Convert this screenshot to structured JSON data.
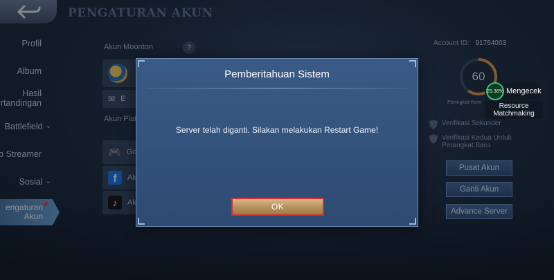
{
  "header": {
    "title": "PENGATURAN AKUN"
  },
  "sidebar": {
    "items": [
      {
        "label": "Profil"
      },
      {
        "label": "Album"
      },
      {
        "label": "Hasil\nrtandingan"
      },
      {
        "label": "Battlefield"
      },
      {
        "label": "o Streamer"
      },
      {
        "label": "Sosial"
      },
      {
        "label": "engaturan\nAkun"
      }
    ]
  },
  "main": {
    "moonton_label": "Akun Moonton",
    "help_symbol": "?",
    "email_stub": "E",
    "platform_label": "Akun Plat",
    "google_stub": "Go",
    "facebook_stub": "Ak",
    "tiktok_stub": "Ak"
  },
  "right_panel": {
    "account_id_label": "Account ID:",
    "account_id_value": "91764003",
    "rank_value": "60",
    "rank_label": "Peringkat Kem",
    "resource_percent": "25.36%",
    "resource_title": "Mengecek",
    "resource_subtitle": "Resource Matchmaking",
    "verify_secondary": "Verifikasi Sekunder",
    "verify_new_device": "Verifikasi Kedua Untuk Perangkat Baru",
    "btn_account_center": "Pusat Akun",
    "btn_switch_account": "Ganti Akun",
    "btn_advance_server": "Advance Server"
  },
  "modal": {
    "title": "Pemberitahuan Sistem",
    "message": "Server telah diganti. Silakan melakukan Restart Game!",
    "ok_label": "OK"
  },
  "colors": {
    "modal_bg": "#3a5b86",
    "ok_button": "#b5905a",
    "ok_highlight_border": "#e02a2a",
    "sidebar_active": "#5a8fc0",
    "rank_ring": "#e69a45"
  }
}
